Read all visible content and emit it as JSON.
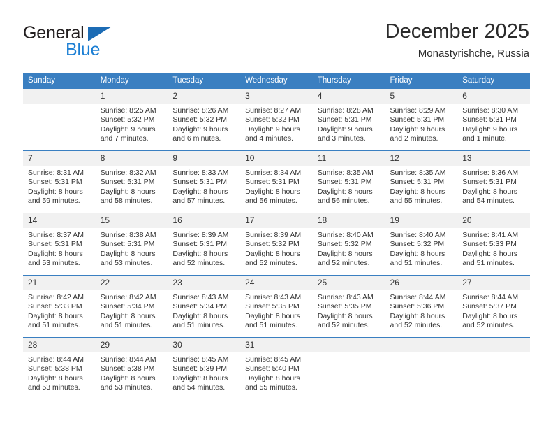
{
  "brand": {
    "name_part1": "General",
    "name_part2": "Blue",
    "accent_color": "#1c7fd4",
    "triangle_color": "#1c6cb5"
  },
  "header": {
    "title": "December 2025",
    "subtitle": "Monastyrishche, Russia"
  },
  "theme": {
    "header_row_color": "#3a7fc1",
    "daynum_band_color": "#f1f1f1",
    "text_color": "#333333"
  },
  "weekday_headers": [
    "Sunday",
    "Monday",
    "Tuesday",
    "Wednesday",
    "Thursday",
    "Friday",
    "Saturday"
  ],
  "labels": {
    "sunrise_prefix": "Sunrise:",
    "sunset_prefix": "Sunset:",
    "daylight_prefix": "Daylight:"
  },
  "weeks": [
    [
      {
        "day": "",
        "sunrise": "",
        "sunset": "",
        "daylight_line1": "",
        "daylight_line2": ""
      },
      {
        "day": "1",
        "sunrise": "Sunrise: 8:25 AM",
        "sunset": "Sunset: 5:32 PM",
        "daylight_line1": "Daylight: 9 hours",
        "daylight_line2": "and 7 minutes."
      },
      {
        "day": "2",
        "sunrise": "Sunrise: 8:26 AM",
        "sunset": "Sunset: 5:32 PM",
        "daylight_line1": "Daylight: 9 hours",
        "daylight_line2": "and 6 minutes."
      },
      {
        "day": "3",
        "sunrise": "Sunrise: 8:27 AM",
        "sunset": "Sunset: 5:32 PM",
        "daylight_line1": "Daylight: 9 hours",
        "daylight_line2": "and 4 minutes."
      },
      {
        "day": "4",
        "sunrise": "Sunrise: 8:28 AM",
        "sunset": "Sunset: 5:31 PM",
        "daylight_line1": "Daylight: 9 hours",
        "daylight_line2": "and 3 minutes."
      },
      {
        "day": "5",
        "sunrise": "Sunrise: 8:29 AM",
        "sunset": "Sunset: 5:31 PM",
        "daylight_line1": "Daylight: 9 hours",
        "daylight_line2": "and 2 minutes."
      },
      {
        "day": "6",
        "sunrise": "Sunrise: 8:30 AM",
        "sunset": "Sunset: 5:31 PM",
        "daylight_line1": "Daylight: 9 hours",
        "daylight_line2": "and 1 minute."
      }
    ],
    [
      {
        "day": "7",
        "sunrise": "Sunrise: 8:31 AM",
        "sunset": "Sunset: 5:31 PM",
        "daylight_line1": "Daylight: 8 hours",
        "daylight_line2": "and 59 minutes."
      },
      {
        "day": "8",
        "sunrise": "Sunrise: 8:32 AM",
        "sunset": "Sunset: 5:31 PM",
        "daylight_line1": "Daylight: 8 hours",
        "daylight_line2": "and 58 minutes."
      },
      {
        "day": "9",
        "sunrise": "Sunrise: 8:33 AM",
        "sunset": "Sunset: 5:31 PM",
        "daylight_line1": "Daylight: 8 hours",
        "daylight_line2": "and 57 minutes."
      },
      {
        "day": "10",
        "sunrise": "Sunrise: 8:34 AM",
        "sunset": "Sunset: 5:31 PM",
        "daylight_line1": "Daylight: 8 hours",
        "daylight_line2": "and 56 minutes."
      },
      {
        "day": "11",
        "sunrise": "Sunrise: 8:35 AM",
        "sunset": "Sunset: 5:31 PM",
        "daylight_line1": "Daylight: 8 hours",
        "daylight_line2": "and 56 minutes."
      },
      {
        "day": "12",
        "sunrise": "Sunrise: 8:35 AM",
        "sunset": "Sunset: 5:31 PM",
        "daylight_line1": "Daylight: 8 hours",
        "daylight_line2": "and 55 minutes."
      },
      {
        "day": "13",
        "sunrise": "Sunrise: 8:36 AM",
        "sunset": "Sunset: 5:31 PM",
        "daylight_line1": "Daylight: 8 hours",
        "daylight_line2": "and 54 minutes."
      }
    ],
    [
      {
        "day": "14",
        "sunrise": "Sunrise: 8:37 AM",
        "sunset": "Sunset: 5:31 PM",
        "daylight_line1": "Daylight: 8 hours",
        "daylight_line2": "and 53 minutes."
      },
      {
        "day": "15",
        "sunrise": "Sunrise: 8:38 AM",
        "sunset": "Sunset: 5:31 PM",
        "daylight_line1": "Daylight: 8 hours",
        "daylight_line2": "and 53 minutes."
      },
      {
        "day": "16",
        "sunrise": "Sunrise: 8:39 AM",
        "sunset": "Sunset: 5:31 PM",
        "daylight_line1": "Daylight: 8 hours",
        "daylight_line2": "and 52 minutes."
      },
      {
        "day": "17",
        "sunrise": "Sunrise: 8:39 AM",
        "sunset": "Sunset: 5:32 PM",
        "daylight_line1": "Daylight: 8 hours",
        "daylight_line2": "and 52 minutes."
      },
      {
        "day": "18",
        "sunrise": "Sunrise: 8:40 AM",
        "sunset": "Sunset: 5:32 PM",
        "daylight_line1": "Daylight: 8 hours",
        "daylight_line2": "and 52 minutes."
      },
      {
        "day": "19",
        "sunrise": "Sunrise: 8:40 AM",
        "sunset": "Sunset: 5:32 PM",
        "daylight_line1": "Daylight: 8 hours",
        "daylight_line2": "and 51 minutes."
      },
      {
        "day": "20",
        "sunrise": "Sunrise: 8:41 AM",
        "sunset": "Sunset: 5:33 PM",
        "daylight_line1": "Daylight: 8 hours",
        "daylight_line2": "and 51 minutes."
      }
    ],
    [
      {
        "day": "21",
        "sunrise": "Sunrise: 8:42 AM",
        "sunset": "Sunset: 5:33 PM",
        "daylight_line1": "Daylight: 8 hours",
        "daylight_line2": "and 51 minutes."
      },
      {
        "day": "22",
        "sunrise": "Sunrise: 8:42 AM",
        "sunset": "Sunset: 5:34 PM",
        "daylight_line1": "Daylight: 8 hours",
        "daylight_line2": "and 51 minutes."
      },
      {
        "day": "23",
        "sunrise": "Sunrise: 8:43 AM",
        "sunset": "Sunset: 5:34 PM",
        "daylight_line1": "Daylight: 8 hours",
        "daylight_line2": "and 51 minutes."
      },
      {
        "day": "24",
        "sunrise": "Sunrise: 8:43 AM",
        "sunset": "Sunset: 5:35 PM",
        "daylight_line1": "Daylight: 8 hours",
        "daylight_line2": "and 51 minutes."
      },
      {
        "day": "25",
        "sunrise": "Sunrise: 8:43 AM",
        "sunset": "Sunset: 5:35 PM",
        "daylight_line1": "Daylight: 8 hours",
        "daylight_line2": "and 52 minutes."
      },
      {
        "day": "26",
        "sunrise": "Sunrise: 8:44 AM",
        "sunset": "Sunset: 5:36 PM",
        "daylight_line1": "Daylight: 8 hours",
        "daylight_line2": "and 52 minutes."
      },
      {
        "day": "27",
        "sunrise": "Sunrise: 8:44 AM",
        "sunset": "Sunset: 5:37 PM",
        "daylight_line1": "Daylight: 8 hours",
        "daylight_line2": "and 52 minutes."
      }
    ],
    [
      {
        "day": "28",
        "sunrise": "Sunrise: 8:44 AM",
        "sunset": "Sunset: 5:38 PM",
        "daylight_line1": "Daylight: 8 hours",
        "daylight_line2": "and 53 minutes."
      },
      {
        "day": "29",
        "sunrise": "Sunrise: 8:44 AM",
        "sunset": "Sunset: 5:38 PM",
        "daylight_line1": "Daylight: 8 hours",
        "daylight_line2": "and 53 minutes."
      },
      {
        "day": "30",
        "sunrise": "Sunrise: 8:45 AM",
        "sunset": "Sunset: 5:39 PM",
        "daylight_line1": "Daylight: 8 hours",
        "daylight_line2": "and 54 minutes."
      },
      {
        "day": "31",
        "sunrise": "Sunrise: 8:45 AM",
        "sunset": "Sunset: 5:40 PM",
        "daylight_line1": "Daylight: 8 hours",
        "daylight_line2": "and 55 minutes."
      },
      {
        "day": "",
        "sunrise": "",
        "sunset": "",
        "daylight_line1": "",
        "daylight_line2": ""
      },
      {
        "day": "",
        "sunrise": "",
        "sunset": "",
        "daylight_line1": "",
        "daylight_line2": ""
      },
      {
        "day": "",
        "sunrise": "",
        "sunset": "",
        "daylight_line1": "",
        "daylight_line2": ""
      }
    ]
  ]
}
